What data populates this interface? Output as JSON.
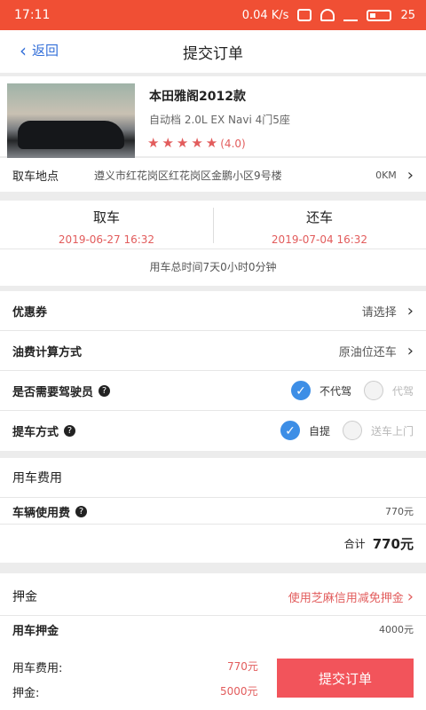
{
  "status": {
    "time": "17:11",
    "speed": "0.04 K/s",
    "battery": "25"
  },
  "nav": {
    "back_label": "返回",
    "title": "提交订单"
  },
  "car": {
    "name": "本田雅阁2012款",
    "spec": "自动档 2.0L EX Navi 4门5座",
    "stars": "★★★★★",
    "score": "(4.0)"
  },
  "pickup_location": {
    "label": "取车地点",
    "address": "遵义市红花岗区红花岗区金鹏小区9号楼",
    "distance": "0KM"
  },
  "dates": {
    "pickup_label": "取车",
    "pickup_time": "2019-06-27 16:32",
    "return_label": "还车",
    "return_time": "2019-07-04 16:32",
    "total": "用车总时间7天0小时0分钟"
  },
  "coupon": {
    "label": "优惠券",
    "value": "请选择"
  },
  "fuel": {
    "label": "油费计算方式",
    "value": "原油位还车"
  },
  "driver": {
    "label": "是否需要驾驶员",
    "option_no": "不代驾",
    "option_yes": "代驾"
  },
  "delivery": {
    "label": "提车方式",
    "option_self": "自提",
    "option_deliver": "送车上门"
  },
  "fees": {
    "section_title": "用车费用",
    "usage_label": "车辆使用费",
    "usage_value": "770元",
    "total_label": "合计",
    "total_value": "770元"
  },
  "deposit": {
    "section_title": "押金",
    "zhima_link": "使用芝麻信用减免押金",
    "label": "用车押金",
    "value": "4000元"
  },
  "bottom_bar": {
    "fee_label": "用车费用:",
    "fee_value": "770元",
    "deposit_label": "押金:",
    "deposit_value": "5000元",
    "submit_label": "提交订单"
  },
  "colors": {
    "status_bar": "#f04f34",
    "accent_red": "#e25c5c",
    "submit": "#f2545b",
    "radio_on": "#3d8ee6",
    "link_blue": "#3470d9"
  }
}
